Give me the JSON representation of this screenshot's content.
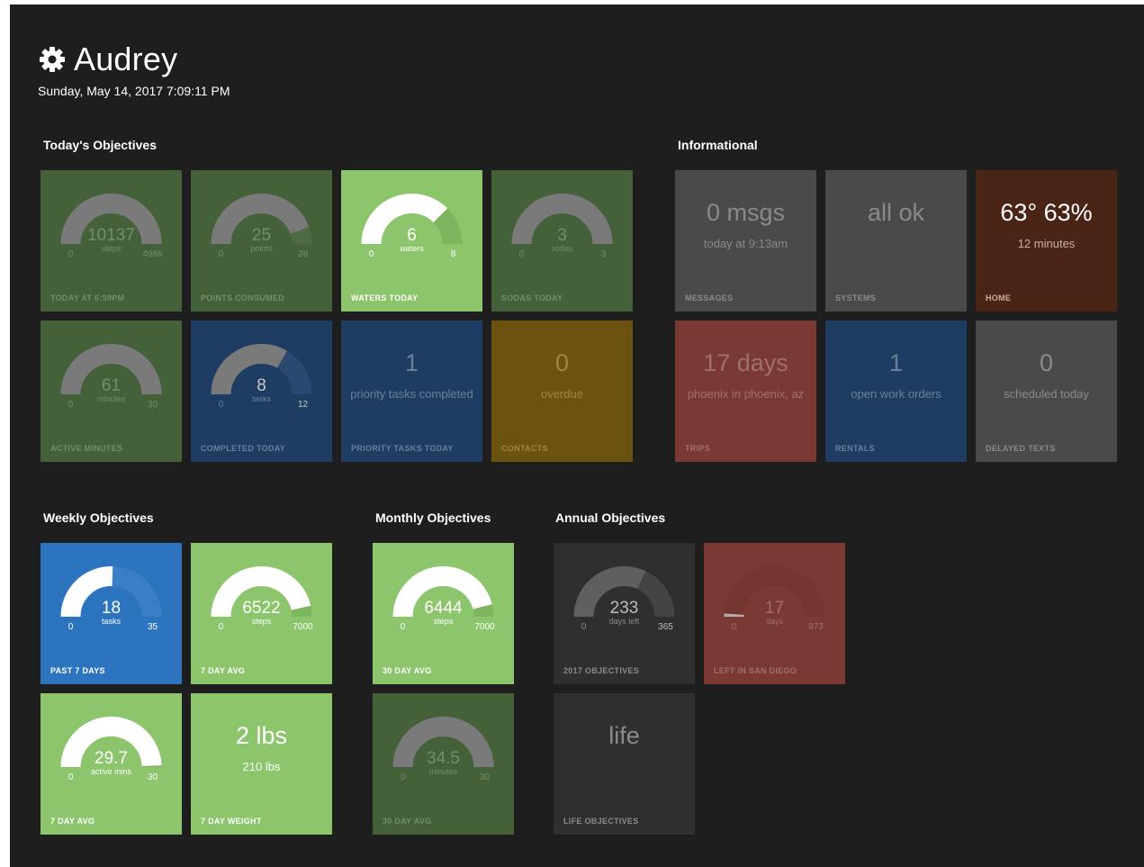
{
  "header": {
    "title": "Audrey",
    "datetime": "Sunday, May 14, 2017  7:09:11 PM"
  },
  "sections": {
    "today": "Today's Objectives",
    "info": "Informational",
    "weekly": "Weekly Objectives",
    "monthly": "Monthly Objectives",
    "annual": "Annual Objectives"
  },
  "today": {
    "steps": {
      "value": "10137",
      "unit": "steps",
      "min": "0",
      "max": "4986",
      "fill": 1.0,
      "caption": "TODAY AT 6:59PM"
    },
    "points": {
      "value": "25",
      "unit": "points",
      "min": "0",
      "max": "28",
      "fill": 0.89,
      "caption": "POINTS CONSUMED"
    },
    "waters": {
      "value": "6",
      "unit": "waters",
      "min": "0",
      "max": "8",
      "fill": 0.75,
      "caption": "WATERS TODAY"
    },
    "sodas": {
      "value": "3",
      "unit": "sodas",
      "min": "0",
      "max": "3",
      "fill": 1.0,
      "caption": "SODAS TODAY"
    },
    "active": {
      "value": "61",
      "unit": "minutes",
      "min": "0",
      "max": "30",
      "fill": 1.0,
      "caption": "ACTIVE MINUTES"
    },
    "tasks": {
      "value": "8",
      "unit": "tasks",
      "min": "0",
      "max": "12",
      "fill": 0.67,
      "caption": "COMPLETED TODAY"
    },
    "priority": {
      "big": "1",
      "sub": "priority tasks completed",
      "caption": "PRIORITY TASKS TODAY"
    },
    "contacts": {
      "big": "0",
      "sub": "overdue",
      "caption": "CONTACTS"
    }
  },
  "info": {
    "messages": {
      "big": "0 msgs",
      "sub": "today at 9:13am",
      "caption": "MESSAGES"
    },
    "systems": {
      "big": "all ok",
      "caption": "SYSTEMS"
    },
    "home": {
      "big": "63°  63%",
      "sub": "12 minutes",
      "caption": "HOME"
    },
    "trips": {
      "big": "17 days",
      "sub": "phoenix in phoenix, az",
      "caption": "TRIPS"
    },
    "rentals": {
      "big": "1",
      "sub": "open work orders",
      "caption": "RENTALS"
    },
    "texts": {
      "big": "0",
      "sub": "scheduled today",
      "caption": "DELAYED TEXTS"
    }
  },
  "weekly": {
    "tasks": {
      "value": "18",
      "unit": "tasks",
      "min": "0",
      "max": "35",
      "fill": 0.51,
      "caption": "PAST 7 DAYS"
    },
    "steps": {
      "value": "6522",
      "unit": "steps",
      "min": "0",
      "max": "7000",
      "fill": 0.93,
      "caption": "7 DAY AVG"
    },
    "active": {
      "value": "29.7",
      "unit": "active mins",
      "min": "0",
      "max": "30",
      "fill": 0.99,
      "caption": "7 DAY AVG"
    },
    "weight": {
      "big": "2 lbs",
      "sub": "210 lbs",
      "caption": "7 DAY WEIGHT"
    }
  },
  "monthly": {
    "steps": {
      "value": "6444",
      "unit": "steps",
      "min": "0",
      "max": "7000",
      "fill": 0.92,
      "caption": "30 DAY AVG"
    },
    "minutes": {
      "value": "34.5",
      "unit": "minutes",
      "min": "0",
      "max": "30",
      "fill": 1.0,
      "caption": "30 DAY AVG"
    }
  },
  "annual": {
    "objectives": {
      "value": "233",
      "unit": "days left",
      "min": "0",
      "max": "365",
      "fill": 0.64,
      "caption": "2017 OBJECTIVES"
    },
    "sandiego": {
      "value": "17",
      "unit": "days",
      "min": "0",
      "max": "973",
      "fill": 0.02,
      "caption": "LEFT IN SAN DIEGO"
    },
    "life": {
      "big": "life",
      "caption": "LIFE OBJECTIVES"
    }
  },
  "colors": {
    "background": "#1e1e1e",
    "dark_green": "#44613a",
    "light_green": "#8cc56b",
    "navy": "#1f3c62",
    "bright_blue": "#2c74be",
    "ochre": "#6b5210",
    "grey": "#4a4a4a",
    "brown": "#4a2414",
    "red": "#7a3a33"
  },
  "icons": {
    "settings": "gear-icon"
  }
}
